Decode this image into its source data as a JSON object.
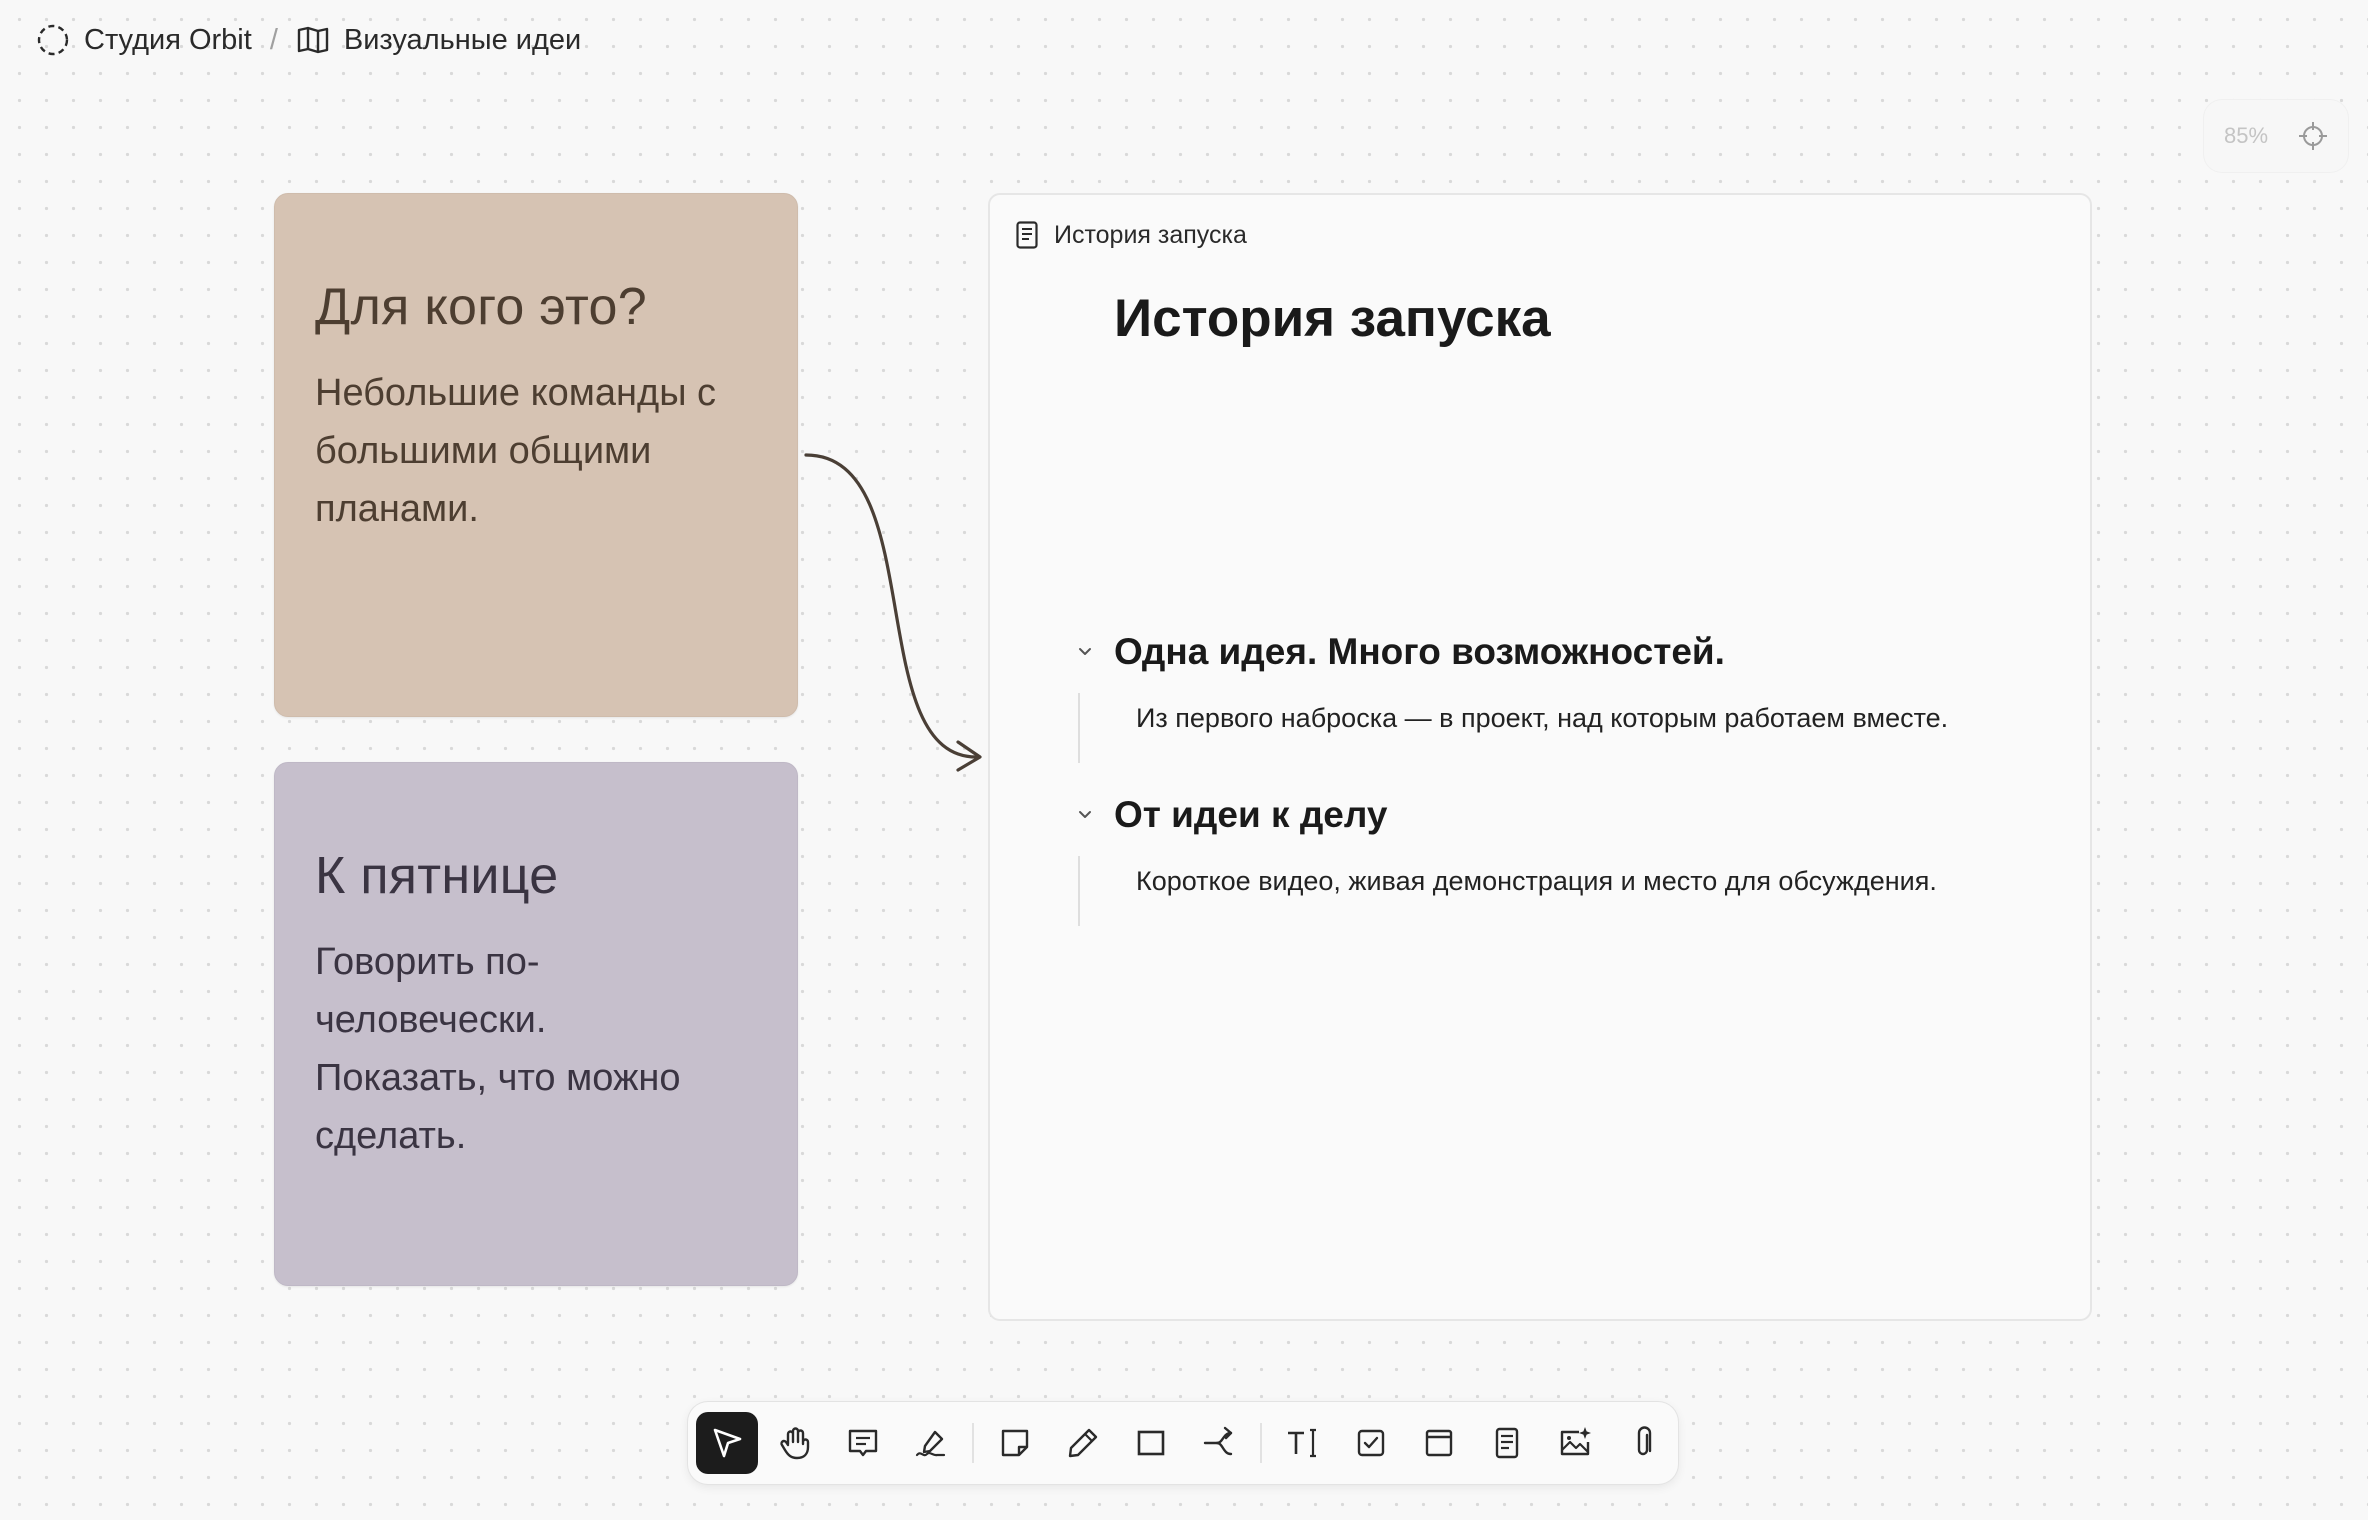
{
  "breadcrumb": {
    "workspace": "Студия Orbit",
    "separator": "/",
    "board": "Визуальные идеи",
    "workspace_icon": "dashed-circle-icon",
    "board_icon": "open-book-icon"
  },
  "zoom": {
    "value": "85%",
    "recenter_icon": "crosshair-icon"
  },
  "stickies": [
    {
      "title": "Для кого это?",
      "body": "Небольшие команды с\nбольшими общими\nпланами.",
      "color": "#d6c3b3"
    },
    {
      "title": "К пятнице",
      "body": "Говорить по-\nчеловечески.\nПоказать, что можно\nсделать.",
      "color": "#c6bfcc"
    }
  ],
  "document": {
    "header_label": "История запуска",
    "title": "История запуска",
    "sections": [
      {
        "title": "Одна идея. Много возможностей.",
        "body": "Из первого наброска — в проект, над которым работаем вместе."
      },
      {
        "title": "От идеи к делу",
        "body": "Короткое видео, живая демонстрация и место для обсуждения."
      }
    ]
  },
  "toolbar": {
    "tools": [
      {
        "name": "select",
        "icon": "cursor-icon",
        "active": true
      },
      {
        "name": "hand",
        "icon": "hand-icon",
        "active": false
      },
      {
        "name": "comment",
        "icon": "comment-icon",
        "active": false
      },
      {
        "name": "signature",
        "icon": "signature-icon",
        "active": false
      },
      {
        "name": "sticky-note",
        "icon": "sticky-note-icon",
        "active": false
      },
      {
        "name": "pen",
        "icon": "pen-icon",
        "active": false
      },
      {
        "name": "rectangle",
        "icon": "rectangle-icon",
        "active": false
      },
      {
        "name": "connector",
        "icon": "connector-icon",
        "active": false
      },
      {
        "name": "text",
        "icon": "text-icon",
        "active": false
      },
      {
        "name": "task",
        "icon": "checkbox-icon",
        "active": false
      },
      {
        "name": "frame",
        "icon": "frame-icon",
        "active": false
      },
      {
        "name": "document",
        "icon": "document-icon",
        "active": false
      },
      {
        "name": "ai-image",
        "icon": "ai-image-icon",
        "active": false
      },
      {
        "name": "attachment",
        "icon": "paperclip-icon",
        "active": false
      }
    ]
  },
  "colors": {
    "canvas": "#f8f8f8",
    "sticky_beige": "#d6c3b3",
    "sticky_lavender": "#c6bfcc",
    "connector": "#4a3f36",
    "toolbar_active": "#1c1c1c"
  }
}
